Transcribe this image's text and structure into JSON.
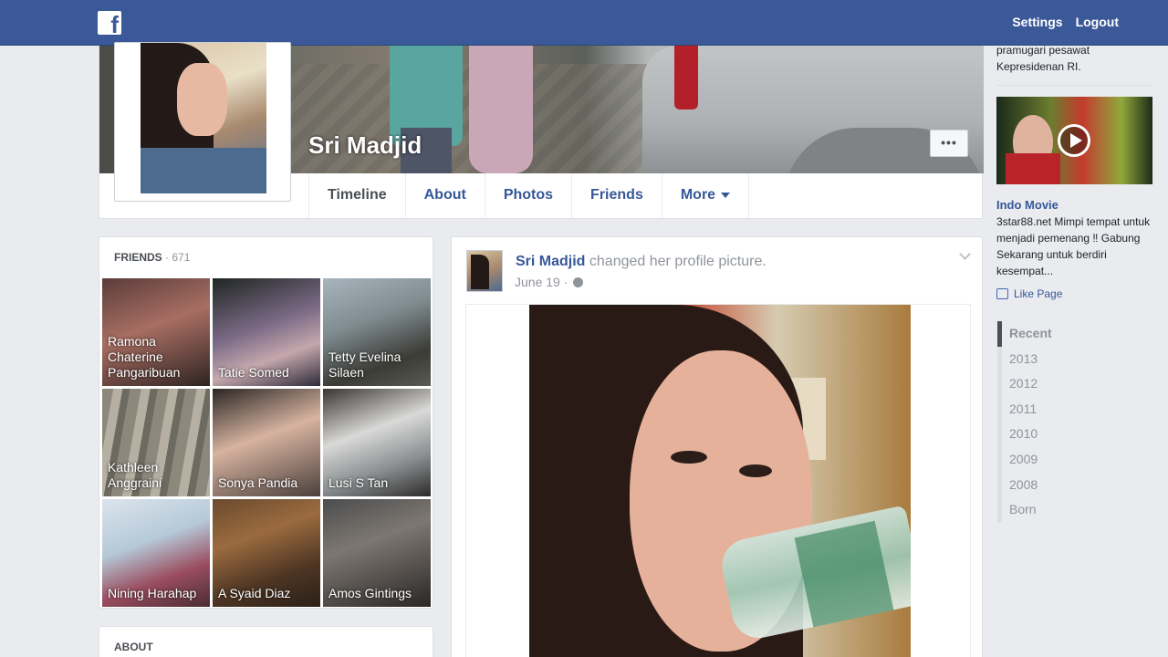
{
  "topbar": {
    "logo_letter": "f",
    "settings_label": "Settings",
    "logout_label": "Logout"
  },
  "profile": {
    "name": "Sri Madjid",
    "more_label": "•••",
    "tabs": [
      {
        "label": "Timeline"
      },
      {
        "label": "About"
      },
      {
        "label": "Photos"
      },
      {
        "label": "Friends"
      },
      {
        "label": "More"
      }
    ]
  },
  "friends": {
    "heading": "FRIENDS",
    "count": "671",
    "items": [
      {
        "name": "Ramona Chaterine Pangaribuan"
      },
      {
        "name": "Tatie Somed"
      },
      {
        "name": "Tetty Evelina Silaen"
      },
      {
        "name": "Kathleen Anggraini"
      },
      {
        "name": "Sonya Pandia"
      },
      {
        "name": "Lusi S Tan"
      },
      {
        "name": "Nining Harahap"
      },
      {
        "name": "A Syaid Diaz"
      },
      {
        "name": "Amos Gintings"
      }
    ]
  },
  "about": {
    "heading": "ABOUT"
  },
  "post": {
    "author": "Sri Madjid",
    "action": "changed her profile picture.",
    "date": "June 19",
    "separator": "·"
  },
  "rail": {
    "ad_text_top": "pramugari pesawat Kepresidenan RI.",
    "ad_title": "Indo Movie",
    "ad_body": "3star88.net Mimpi tempat untuk menjadi pemenang ‼ Gabung Sekarang untuk berdiri kesempat...",
    "like_label": "Like Page",
    "years": [
      "Recent",
      "2013",
      "2012",
      "2011",
      "2010",
      "2009",
      "2008",
      "Born"
    ]
  },
  "colors": {
    "brand": "#3b5998",
    "link": "#365899",
    "background": "#e9ebee"
  }
}
